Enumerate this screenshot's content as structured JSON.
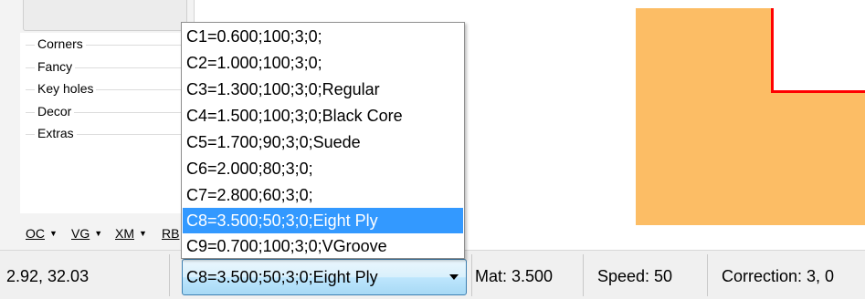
{
  "sidebar": {
    "categories": [
      "Corners",
      "Fancy",
      "Key holes",
      "Decor",
      "Extras"
    ],
    "toolbar": [
      {
        "label": "OC"
      },
      {
        "label": "VG"
      },
      {
        "label": "XM"
      },
      {
        "label": "RB"
      }
    ]
  },
  "dropdown": {
    "options": [
      "C1=0.600;100;3;0;",
      "C2=1.000;100;3;0;",
      "C3=1.300;100;3;0;Regular",
      "C4=1.500;100;3;0;Black Core",
      "C5=1.700;90;3;0;Suede",
      "C6=2.000;80;3;0;",
      "C7=2.800;60;3;0;",
      "C8=3.500;50;3;0;Eight Ply",
      "C9=0.700;100;3;0;VGroove"
    ],
    "selected_index": 7
  },
  "status": {
    "coords": "2.92, 32.03",
    "combo_value": "C8=3.500;50;3;0;Eight Ply",
    "mat": "Mat: 3.500",
    "speed": "Speed: 50",
    "correction": "Correction: 3, 0"
  },
  "colors": {
    "shape_fill": "#fcbd65",
    "shape_outline": "#ff0000",
    "selection": "#3399ff"
  }
}
